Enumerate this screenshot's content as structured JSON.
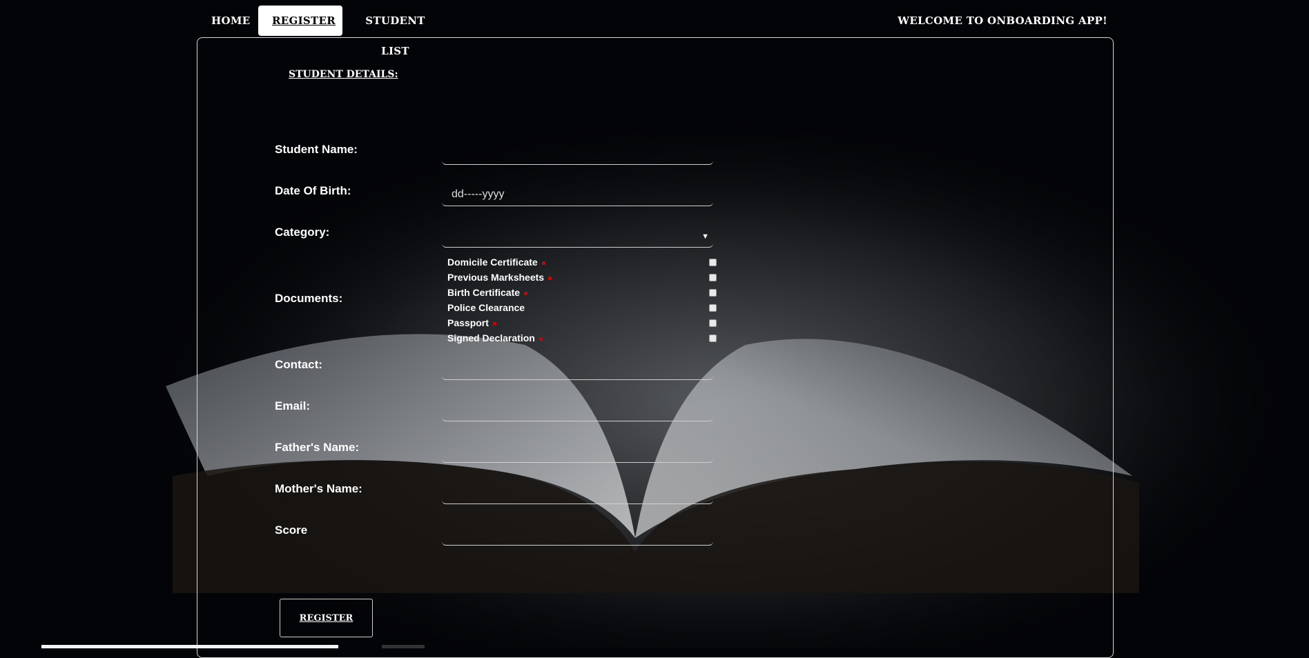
{
  "nav": {
    "home": "HOME",
    "register": "REGISTER",
    "student_list": "STUDENT LIST",
    "welcome": "WELCOME TO ONBOARDING APP!"
  },
  "form": {
    "title": "STUDENT DETAILS:",
    "student_name_label": "Student Name:",
    "dob_label": "Date Of Birth:",
    "dob_value": "dd-----yyyy",
    "category_label": "Category:",
    "documents_label": "Documents:",
    "documents": [
      {
        "label": "Domicile Certificate",
        "required": true
      },
      {
        "label": "Previous Marksheets",
        "required": true
      },
      {
        "label": "Birth Certificate",
        "required": true
      },
      {
        "label": "Police Clearance",
        "required": false
      },
      {
        "label": "Passport",
        "required": true
      },
      {
        "label": "Signed Declaration",
        "required": true
      }
    ],
    "contact_label": "Contact:",
    "email_label": "Email:",
    "father_label": "Father's Name:",
    "mother_label": "Mother's Name:",
    "score_label": "Score",
    "submit": "REGISTER"
  },
  "colors": {
    "background": "#030407",
    "required_marker": "#d10000",
    "active_tab": "#ffffff"
  }
}
